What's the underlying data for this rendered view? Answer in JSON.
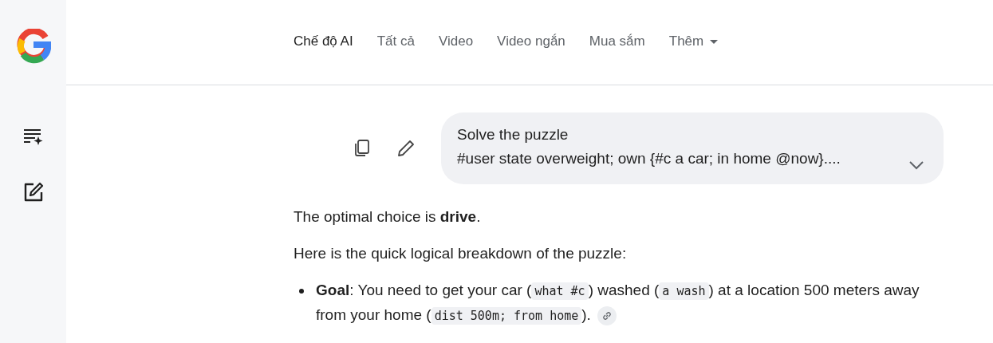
{
  "tabs": [
    {
      "label": "Chế độ AI",
      "selected": true
    },
    {
      "label": "Tất cả",
      "selected": false
    },
    {
      "label": "Video",
      "selected": false
    },
    {
      "label": "Video ngắn",
      "selected": false
    },
    {
      "label": "Mua sắm",
      "selected": false
    },
    {
      "label": "Thêm",
      "selected": false,
      "dropdown": true
    }
  ],
  "prompt": {
    "lines": [
      "Solve the puzzle",
      "#user state overweight; own {#c a car; in home @now}...."
    ],
    "expanded": false
  },
  "answer": {
    "paragraphs": [
      "The optimal choice is **drive**.",
      "Here is the quick logical breakdown of the puzzle:"
    ],
    "bullets": [
      {
        "segments": [
          {
            "kind": "bold",
            "text": "Goal"
          },
          {
            "kind": "text",
            "text": ": You need to get your car ("
          },
          {
            "kind": "code",
            "text": "what #c"
          },
          {
            "kind": "text",
            "text": ") washed ("
          },
          {
            "kind": "code",
            "text": "a wash"
          },
          {
            "kind": "text",
            "text": ") at a location 500 meters away from your home ("
          },
          {
            "kind": "code",
            "text": "dist 500m; from home"
          },
          {
            "kind": "text",
            "text": ")."
          }
        ],
        "link": true
      }
    ]
  }
}
